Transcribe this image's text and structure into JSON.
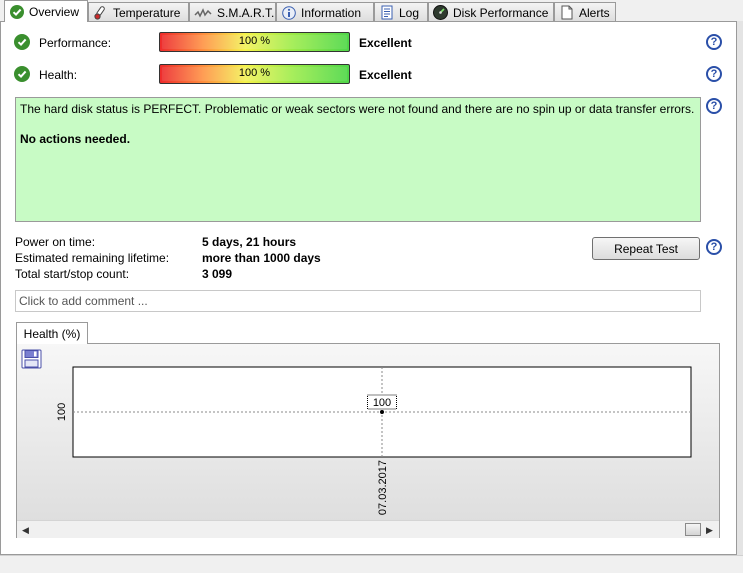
{
  "tabs": [
    {
      "label": "Overview",
      "icon": "check-circle-icon"
    },
    {
      "label": "Temperature",
      "icon": "thermometer-icon"
    },
    {
      "label": "S.M.A.R.T.",
      "icon": "chart-wave-icon"
    },
    {
      "label": "Information",
      "icon": "info-icon"
    },
    {
      "label": "Log",
      "icon": "log-document-icon"
    },
    {
      "label": "Disk Performance",
      "icon": "gauge-icon"
    },
    {
      "label": "Alerts",
      "icon": "alerts-document-icon"
    }
  ],
  "metrics": {
    "performance": {
      "label": "Performance:",
      "value_text": "100 %",
      "value": 100,
      "verdict": "Excellent"
    },
    "health": {
      "label": "Health:",
      "value_text": "100 %",
      "value": 100,
      "verdict": "Excellent"
    }
  },
  "status": {
    "message": "The hard disk status is PERFECT. Problematic or weak sectors were not found and there are no spin up or data transfer errors.",
    "action": "No actions needed.",
    "background_color": "#c8fbc5"
  },
  "info": [
    {
      "label": "Power on time:",
      "value": "5 days, 21 hours"
    },
    {
      "label": "Estimated remaining lifetime:",
      "value": "more than 1000 days"
    },
    {
      "label": "Total start/stop count:",
      "value": "3 099"
    }
  ],
  "repeat_test_label": "Repeat Test",
  "comment_placeholder": "Click to add comment ...",
  "chart_tab_label": "Health (%)",
  "chart_data": {
    "type": "line",
    "x": [
      "07.03.2017"
    ],
    "series": [
      {
        "values": [
          100
        ]
      }
    ],
    "x_tick_labels": [
      "07.03.2017"
    ],
    "y_tick_labels": [
      "100"
    ],
    "data_labels": [
      "100"
    ],
    "grid": true
  },
  "colors": {
    "help": "#2a4fa8",
    "ok": "#3a8f2e"
  }
}
